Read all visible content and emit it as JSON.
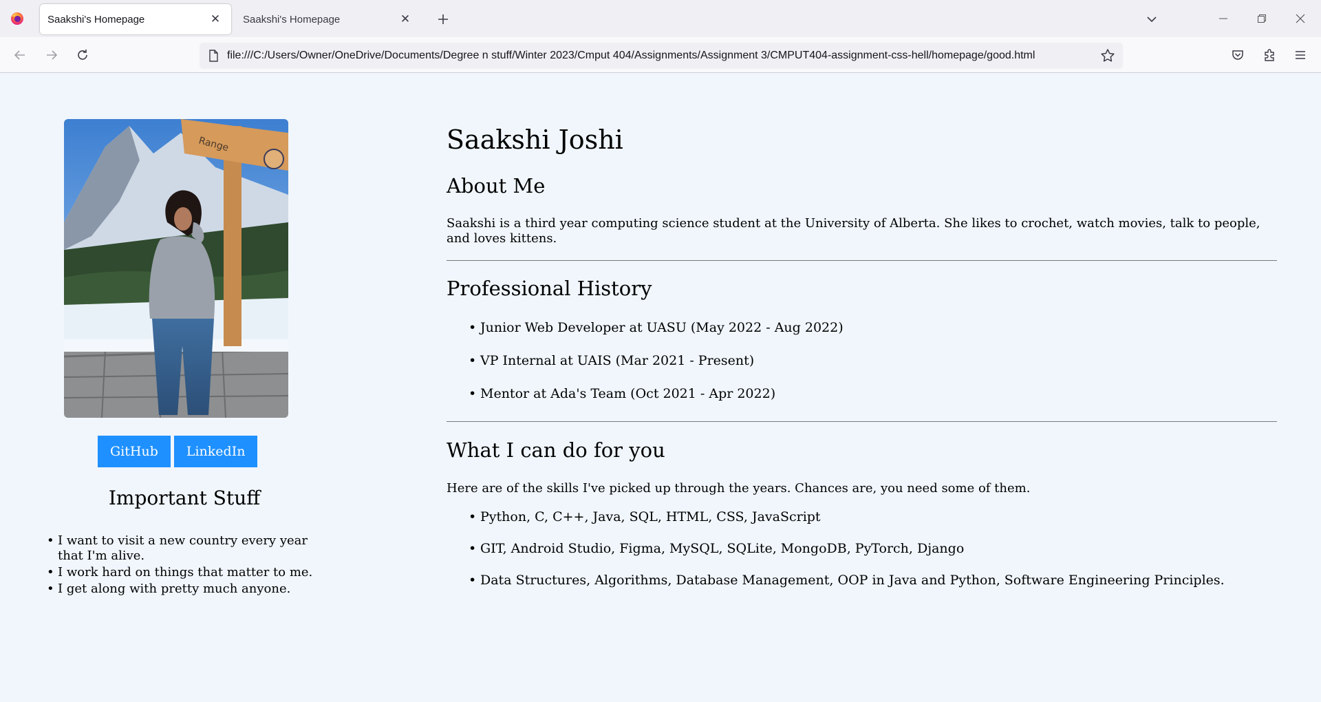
{
  "browser": {
    "tabs": [
      {
        "title": "Saakshi's Homepage",
        "active": true
      },
      {
        "title": "Saakshi's Homepage",
        "active": false
      }
    ],
    "url": "file:///C:/Users/Owner/OneDrive/Documents/Degree n stuff/Winter 2023/Cmput 404/Assignments/Assignment 3/CMPUT404-assignment-css-hell/homepage/good.html",
    "icons": {
      "app": "firefox-icon",
      "new_tab": "plus-icon",
      "tab_list": "chevron-down-icon",
      "back": "arrow-left-icon",
      "forward": "arrow-right-icon",
      "reload": "reload-icon",
      "page": "page-icon",
      "bookmark": "star-icon",
      "pocket": "pocket-icon",
      "extensions": "puzzle-icon",
      "menu": "hamburger-icon"
    }
  },
  "sidebar": {
    "buttons": {
      "github": "GitHub",
      "linkedin": "LinkedIn"
    },
    "important_title": "Important Stuff",
    "important_items": [
      "I want to visit a new country every year that I'm alive.",
      "I work hard on things that matter to me.",
      "I get along with pretty much anyone."
    ]
  },
  "main": {
    "name": "Saakshi Joshi",
    "about_title": "About Me",
    "about_text": "Saakshi is a third year computing science student at the University of Alberta. She likes to crochet, watch movies, talk to people, and loves kittens.",
    "professional_title": "Professional History",
    "professional_items": [
      "Junior Web Developer at UASU (May 2022 - Aug 2022)",
      "VP Internal at UAIS (Mar 2021 - Present)",
      "Mentor at Ada's Team (Oct 2021 - Apr 2022)"
    ],
    "skills_title": "What I can do for you",
    "skills_intro": "Here are of the skills I've picked up through the years. Chances are, you need some of them.",
    "skills_items": [
      "Python, C, C++, Java, SQL, HTML, CSS, JavaScript",
      "GIT, Android Studio, Figma, MySQL, SQLite, MongoDB, PyTorch, Django",
      "Data Structures, Algorithms, Database Management, OOP in Java and Python, Software Engineering Principles."
    ]
  },
  "colors": {
    "page_background": "#f0f6fc",
    "button_blue": "#1e90ff",
    "tab_bar": "#f0f0f4",
    "nav_bar": "#f9f9fb"
  }
}
